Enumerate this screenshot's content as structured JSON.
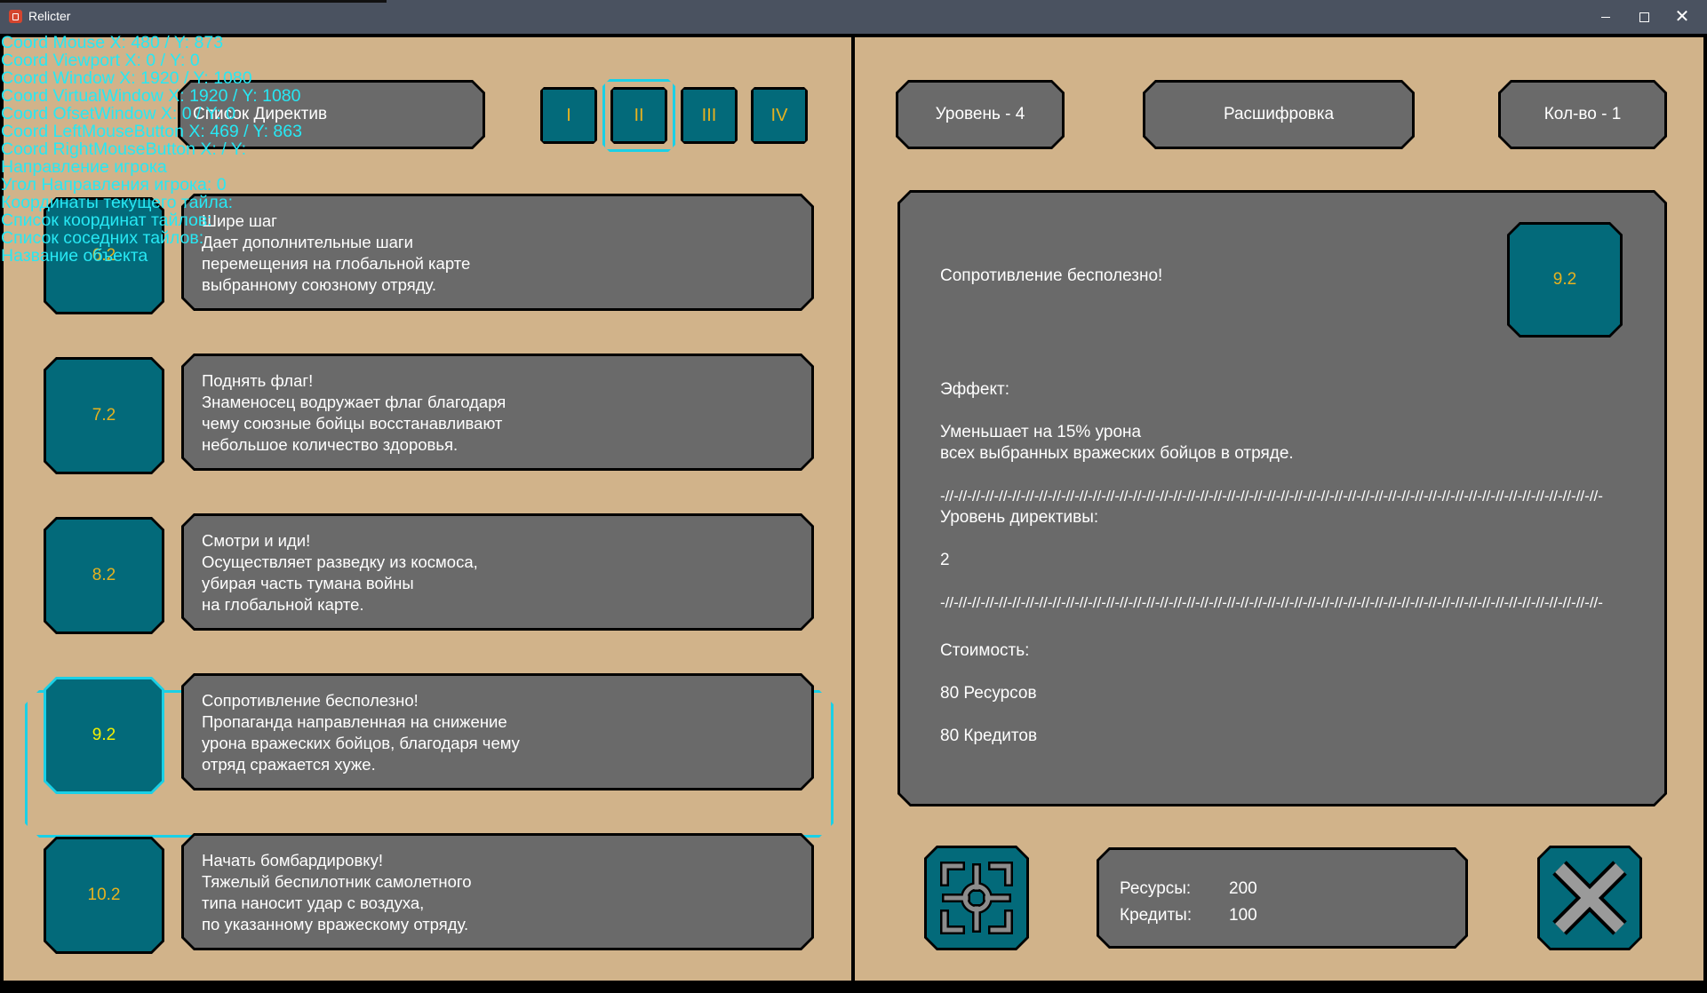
{
  "window": {
    "title": "Relicter"
  },
  "left": {
    "list_title": "Список Директив",
    "tiers": [
      {
        "label": "I",
        "selected": false
      },
      {
        "label": "II",
        "selected": true
      },
      {
        "label": "III",
        "selected": false
      },
      {
        "label": "IV",
        "selected": false
      }
    ],
    "directives": [
      {
        "level": "6.2",
        "title": "Шире шаг",
        "lines": [
          "Дает дополнительные шаги",
          "перемещения на глобальной карте",
          "выбранному союзному отряду."
        ]
      },
      {
        "level": "7.2",
        "title": "Поднять флаг!",
        "lines": [
          "Знаменосец водружает флаг благодаря",
          "чему союзные бойцы восстанавливают",
          "небольшое количество здоровья."
        ]
      },
      {
        "level": "8.2",
        "title": "Смотри и иди!",
        "lines": [
          "Осуществляет разведку из космоса,",
          "убирая часть тумана войны",
          "на глобальной карте."
        ]
      },
      {
        "level": "9.2",
        "title": "Сопротивление бесполезно!",
        "lines": [
          "Пропаганда направленная на снижение",
          "урона вражеских бойцов, благодаря чему",
          "отряд сражается хуже."
        ]
      },
      {
        "level": "10.2",
        "title": "Начать бомбардировку!",
        "lines": [
          "Тяжелый беспилотник самолетного",
          "типа наносит удар с воздуха,",
          "по указанному вражескому отряду."
        ]
      }
    ],
    "selected_index": 3
  },
  "right": {
    "level_label": "Уровень - 4",
    "decode_label": "Расшифровка",
    "count_label": "Кол-во - 1",
    "detail": {
      "name": "Сопротивление бесполезно!",
      "badge": "9.2",
      "effect_header": "Эффект:",
      "effect_line1": "Уменьшает на 15% урона",
      "effect_line2": "всех выбранных вражеских бойцов в отряде.",
      "separator": "-//-//-//-//-//-//-//-//-//-//-//-//-//-//-//-//-//-//-//-//-//-//-//-//-//-//-//-//-//-//-//-//-//-//-//-//-//-//-//-//-//-//-//-//-//-//-//-//-//-",
      "level_header": "Уровень директивы:",
      "level_value": "2",
      "cost_header": "Стоимость:",
      "cost_resources": "80 Ресурсов",
      "cost_credits": "80 Кредитов"
    },
    "resources": {
      "res_label": "Ресурсы:",
      "res_value": "200",
      "cred_label": "Кредиты:",
      "cred_value": "100"
    }
  },
  "debug_lines": [
    "Coord Mouse X: 480 / Y: 873",
    "Coord Viewport X: 0 / Y: 0",
    "Coord Window X: 1920 / Y: 1080",
    "Coord VirtualWindow X: 1920 / Y: 1080",
    "Coord OfsetWindow X: 0 / Y: 0",
    "Coord LeftMouseButton X: 469 / Y: 863",
    "Coord RightMouseButton X: / Y:",
    "Направление игрока",
    "Угол Направления игрока: 0",
    "Координаты текущего тайла:",
    "Список координат тайлов:",
    "Список соседних тайлов:",
    "Название объекта"
  ],
  "colors": {
    "panel_bg": "#d1b38a",
    "card_bg": "#6a6a6a",
    "teal": "#036a7a",
    "accent_cyan": "#1ad0e6",
    "level_text": "#e7b21f"
  }
}
